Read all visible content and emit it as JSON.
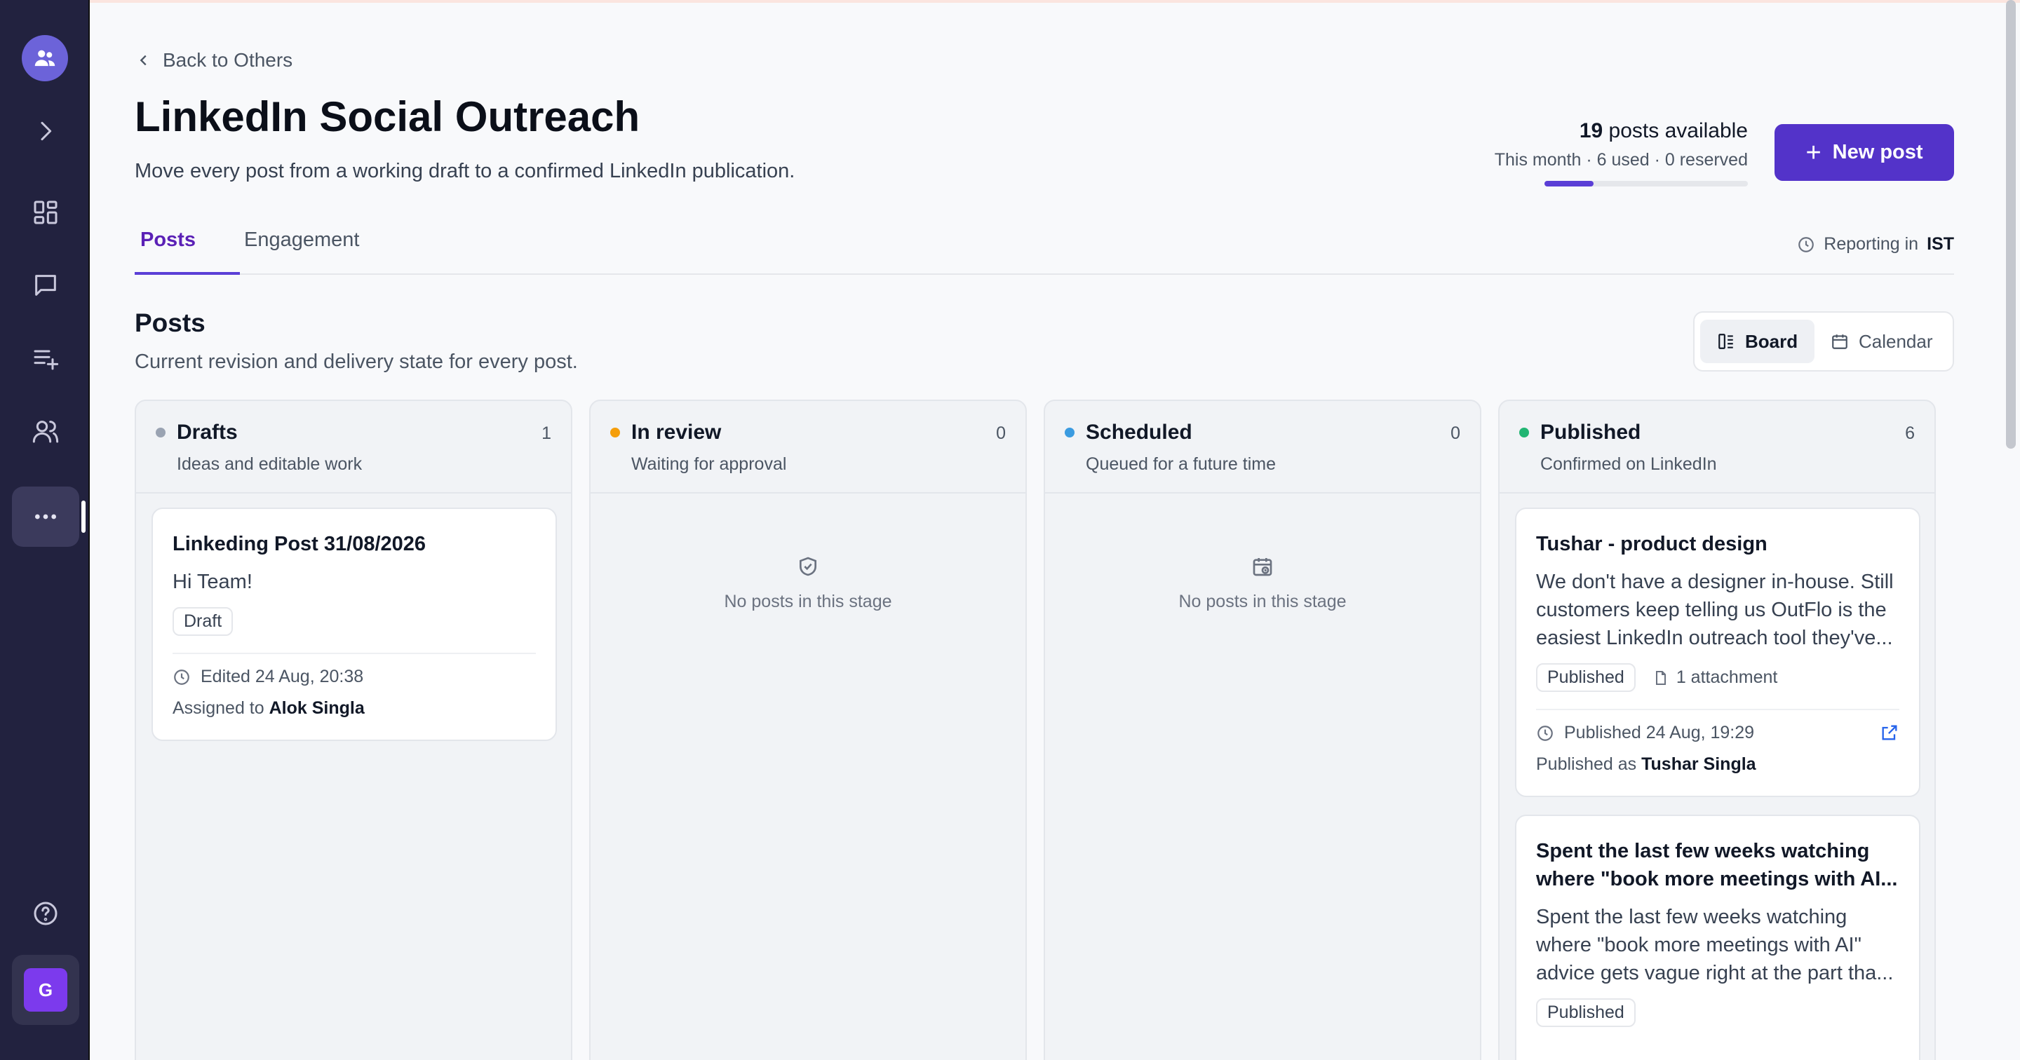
{
  "sidebar": {
    "logo_icon": "team-icon",
    "items": [
      {
        "icon": "chevron-right-icon"
      },
      {
        "icon": "dashboard-icon"
      },
      {
        "icon": "chat-icon"
      },
      {
        "icon": "list-add-icon"
      },
      {
        "icon": "users-icon"
      },
      {
        "icon": "more-icon"
      },
      {
        "icon": "help-icon"
      }
    ],
    "avatar_initial": "G"
  },
  "header": {
    "back_label": "Back to Others",
    "title": "LinkedIn Social Outreach",
    "subtitle": "Move every post from a working draft to a confirmed LinkedIn publication."
  },
  "quota": {
    "count": "19",
    "label": " posts available",
    "detail": "This month · 6 used · 0 reserved",
    "used_fraction": 0.24
  },
  "new_post_label": "New post",
  "tabs": [
    {
      "label": "Posts",
      "active": true
    },
    {
      "label": "Engagement",
      "active": false
    }
  ],
  "reporting": {
    "prefix": "Reporting in",
    "tz": "IST"
  },
  "section": {
    "title": "Posts",
    "subtitle": "Current revision and delivery state for every post."
  },
  "views": [
    {
      "label": "Board",
      "active": true
    },
    {
      "label": "Calendar",
      "active": false
    }
  ],
  "columns": [
    {
      "title": "Drafts",
      "count": "1",
      "desc": "Ideas and editable work",
      "color": "#9aa3b2",
      "cards": [
        {
          "title": "Linkeding Post 31/08/2026",
          "body": "Hi Team!",
          "status": "Draft",
          "time": "Edited 24 Aug, 20:38",
          "person_prefix": "Assigned to",
          "person": "Alok Singla"
        }
      ]
    },
    {
      "title": "In review",
      "count": "0",
      "desc": "Waiting for approval",
      "color": "#f59e0b",
      "empty": "No posts in this stage"
    },
    {
      "title": "Scheduled",
      "count": "0",
      "desc": "Queued for a future time",
      "color": "#3b9be0",
      "empty": "No posts in this stage"
    },
    {
      "title": "Published",
      "count": "6",
      "desc": "Confirmed on LinkedIn",
      "color": "#22b573",
      "cards": [
        {
          "title": "Tushar - product design",
          "body": "We don't have a designer in-house. Still customers keep telling us OutFlo is the easiest LinkedIn outreach tool they've...",
          "status": "Published",
          "attachment": "1 attachment",
          "time": "Published 24 Aug, 19:29",
          "person_prefix": "Published as",
          "person": "Tushar Singla"
        },
        {
          "title": "Spent the last few weeks watching where \"book more meetings with AI...",
          "body": "Spent the last few weeks watching where \"book more meetings with AI\" advice gets vague right at the part tha...",
          "status": "Published"
        }
      ]
    }
  ]
}
